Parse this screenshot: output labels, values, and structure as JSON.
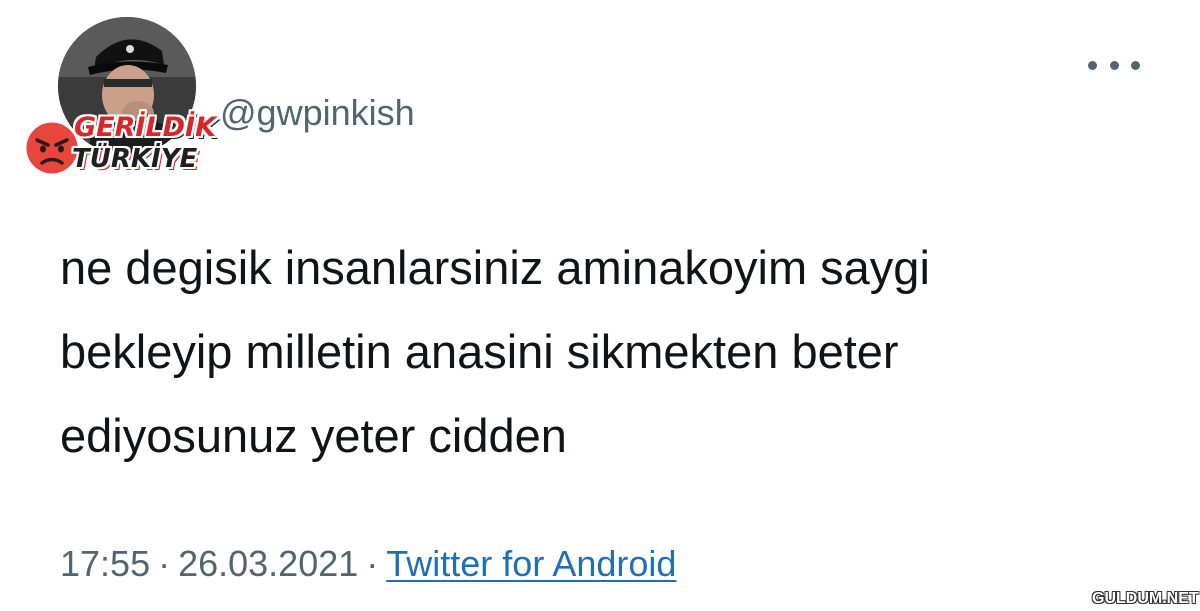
{
  "tweet": {
    "handle": "@gwpinkish",
    "text_lines": [
      "ne degisik insanlarsiniz aminakoyim saygi",
      "bekleyip milletin anasini sikmekten beter",
      "ediyosunuz yeter cidden"
    ],
    "time": "17:55",
    "date": "26.03.2021",
    "source": "Twitter for Android",
    "separator": "·"
  },
  "badge": {
    "line1": "GERİLDİK",
    "line2": "TÜRKİYE",
    "icon": "angry-face-icon"
  },
  "watermark": "GULDUM.NET",
  "more_icon": "more-options-icon",
  "colors": {
    "text": "#0f1419",
    "muted": "#536471",
    "link": "#1d6fb8",
    "badge_red": "#d8262d"
  }
}
